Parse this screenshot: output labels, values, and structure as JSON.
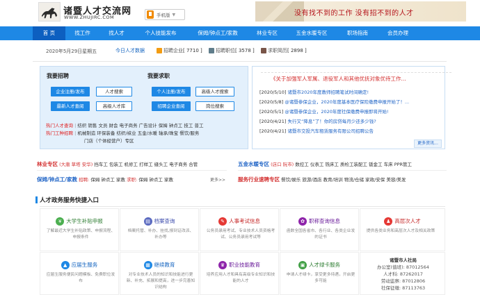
{
  "header": {
    "site_title": "诸暨人才交流网",
    "site_url": "WWW.ZHUJIRC.COM",
    "mobile_label": "手机版",
    "slogan": "没有找不到的工作 没有招不到的人才"
  },
  "nav": {
    "items": [
      "首 页",
      "找工作",
      "找人才",
      "个人技能发布",
      "保姆/钟点工/家教",
      "林业专区",
      "五金水暖专区",
      "职场指南",
      "会员办理"
    ]
  },
  "info": {
    "date": "2020年5月29日星期五",
    "today_label": "今日人才数据",
    "stats": [
      {
        "label": "招聘企业",
        "value": "[ 7710 ]"
      },
      {
        "label": "招聘职位",
        "value": "[ 3578 ]"
      },
      {
        "label": "求职简历",
        "value": "[ 2898 ]"
      }
    ]
  },
  "recruit": {
    "title": "我要招聘",
    "buttons": [
      "企业注册/发布",
      "人才搜索",
      "最新人才查阅",
      "高级人才库"
    ]
  },
  "jobseek": {
    "title": "我要求职",
    "buttons": [
      "个人注册/发布",
      "高级人才搜索",
      "招聘企业查阅",
      "岗位搜索"
    ]
  },
  "hot": {
    "talent_label": "热门人才查询",
    "talent_items": "纺织 销售 文员 财会 电子商务 广告设计 保姆 钟点工 技工 普工",
    "job_label": "热门工种招聘",
    "job_items_1": "机械制造 环保装备 纺织/袜业 五金/水暖 轴承/珠宝 餐饮/服务",
    "job_items_2": "门店（个体经营户）专区"
  },
  "announce": {
    "title": "《关于加强军人军属、退役军人和其他优抚对象优待工作...",
    "news": [
      {
        "date": "[2020/5/10]",
        "text": "诸暨市2020年度教师招聘笔试时间确定!"
      },
      {
        "date": "[2020/5/8]",
        "text": "@诸暨参保企业，2020年度基本医疗保险缴费申报开始了！..."
      },
      {
        "date": "[2020/5/1]",
        "text": "@诸暨参保企业，2020年度社保缴费申报即将开始!"
      },
      {
        "date": "[2020/4/21]",
        "text": "失行又“降息”了！你的房贷每月少还多少钱?"
      },
      {
        "date": "[2020/4/21]",
        "text": "诸暨市交投汽车租赁服务有限公司招聘公告"
      }
    ],
    "more": "更多资讯..."
  },
  "zones": {
    "forestry_title": "林业专区",
    "forestry_sub": "(大唐 草塔 安华)",
    "forestry_items": "挡车工 包装工 机修工 打样工 缝头工 电子商务 合管",
    "hardware_title": "五金水暖专区",
    "hardware_sub": "(店口 阮市)",
    "hardware_items": "数控工 仪表工 铣床工 质检工装配工 钣金工 车床 PPR管工",
    "nanny_title": "保姆/钟点工/家教",
    "nanny_recruit": "招聘:",
    "nanny_recruit_items": "保姆 钟点工 家教",
    "nanny_seek": "求职:",
    "nanny_seek_items": "保姆 钟点工 家教",
    "nanny_more": "更多>>",
    "service_title": "服务行业速聘专区",
    "service_items": "餐饮/娱乐 旅游/酒店 教育/培训 物流/仓储 家政/安保 美容/美发"
  },
  "services": {
    "title": "人才政务服务快捷入口",
    "cells": [
      {
        "title": "大学生补贴申报",
        "desc": "了解最近大学生补贴政策、申报流程、申报条件",
        "icon": "graduate-icon",
        "color": "#4caf50"
      },
      {
        "title": "档案查询",
        "desc": "档案托管、补办、挂找,报到证改派、补办等",
        "icon": "archive-icon",
        "color": "#5c6bc0"
      },
      {
        "title": "人事考试信息",
        "desc": "公务员录用考试、专业技术人员资格考试、公务员录用考试等",
        "icon": "exam-icon",
        "color": "#e53935"
      },
      {
        "title": "职称查询信息",
        "desc": "函数全国各省市、各行业、各类企业发的证书",
        "icon": "certificate-icon",
        "color": "#8e24aa"
      },
      {
        "title": "高层次人才",
        "desc": "提供各类业务和高层次人才及相关政策",
        "icon": "talent-icon",
        "color": "#e53935"
      },
      {
        "title": "应届生服务",
        "desc": "应届生服务便民问题模板、免费职位发布",
        "icon": "cap-icon",
        "color": "#1e88e5"
      },
      {
        "title": "继续教育",
        "desc": "对专业技术人员的知识和技能进行更新、补充、拓展和提高，进一步完善知识结构",
        "icon": "book-icon",
        "color": "#1e88e5"
      },
      {
        "title": "职业技能教育",
        "desc": "培养应用人才和具有高级专业知识和技能的人才",
        "icon": "skill-icon",
        "color": "#8e24aa"
      },
      {
        "title": "人才绿卡服务",
        "desc": "申请人才绿卡，享受更多待遇，开启更多可能",
        "icon": "card-icon",
        "color": "#43a047"
      }
    ],
    "contact": {
      "org": "诸暨市人社局",
      "office": "办公室(值班): 87012564",
      "talent": "人才科: 87262017",
      "labor": "劳动监察: 87012806",
      "social": "社保征缴: 87113763"
    }
  }
}
